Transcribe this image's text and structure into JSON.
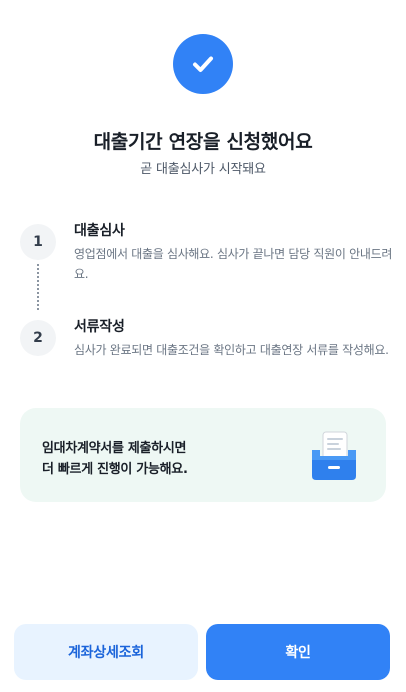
{
  "header": {
    "icon": "check-icon",
    "title": "대출기간 연장을 신청했어요",
    "subtitle": "곧 대출심사가 시작돼요"
  },
  "steps": [
    {
      "number": "1",
      "title": "대출심사",
      "description": "영업점에서 대출을 심사해요. 심사가 끝나면 담당 직원이 안내드려요."
    },
    {
      "number": "2",
      "title": "서류작성",
      "description": "심사가 완료되면 대출조건을 확인하고 대출연장 서류를 작성해요."
    }
  ],
  "info_card": {
    "line1": "임대차계약서를 제출하시면",
    "line2": "더 빠르게 진행이 가능해요.",
    "icon": "document-tray-icon"
  },
  "buttons": {
    "secondary_label": "계좌상세조회",
    "primary_label": "확인"
  },
  "colors": {
    "accent": "#3182f6",
    "secondary_bg": "#e8f3ff",
    "card_bg": "#eef8f4"
  }
}
